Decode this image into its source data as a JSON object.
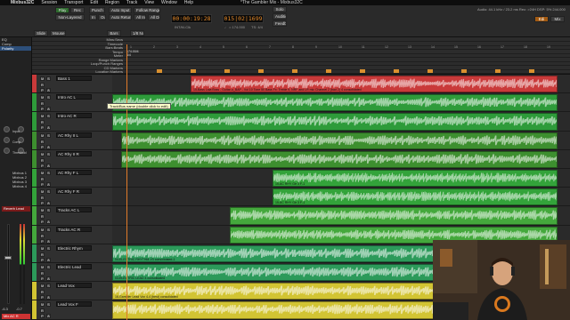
{
  "menubar": {
    "apple": "",
    "app": "Mixbus32C",
    "items": [
      "Session",
      "Transport",
      "Edit",
      "Region",
      "Track",
      "View",
      "Window",
      "Help"
    ],
    "window_title": "*The Gambler Mix - Mixbus32C"
  },
  "toolbar": {
    "punch": "Punch",
    "in": "In",
    "out": "Out",
    "auto_input": "Auto Input",
    "follow_range": "Follow Range",
    "play": "Play",
    "rec": "Rec",
    "non_layered": "Non-Layered",
    "all_in": "All In",
    "all_dsk": "All Disk",
    "auto_return": "Auto Return",
    "clock_primary": "00:00:19:28",
    "clock_secondary": "015|02|1699",
    "clock_primary_sub": "INT/M-Clk",
    "clock_secondary_sub": "TS: 4/4",
    "clock_secondary_sub2": "♩ = 174.000",
    "solo": "Solo",
    "audition": "Audition",
    "feedback": "Feedback",
    "status": "Audio: 44.1 kHz / 23.2 ms   Rec: >24H   DSP: 5%   244.000",
    "editor_btn": "Edi",
    "mixer_btn": "Mix"
  },
  "editbar": {
    "slide": "Slide",
    "mouse": "Mouse",
    "bars": "Bars",
    "nudge_toggle": "No Grid",
    "bars2": "1/8 Note"
  },
  "leftpanel": {
    "items": [
      "EQ",
      "Comp",
      "Polarity"
    ],
    "selected": "Polarity",
    "labels": [
      "Input",
      "Comp",
      "Threshold",
      "Makeup",
      "Attack",
      "Release"
    ],
    "buses": [
      "Mixbus 1",
      "Mixbus 2",
      "Mixbus 3",
      "Mixbus 4"
    ],
    "fx_label": "Reverb Lead",
    "master_label": "Mix AC R",
    "meter_val_1": "-6.3",
    "meter_val_2": "-0.7"
  },
  "rulers": {
    "rows": [
      "Mins:Secs",
      "Timecode",
      "Bars:Beats",
      "Tempo",
      "Meter",
      "Range Markers",
      "Loop/Punch Ranges",
      "CD Markers",
      "Location Markers"
    ],
    "time_sig": "4/4",
    "tempo_value": "174.00/4",
    "bar_numbers": [
      "1",
      "2",
      "3",
      "4",
      "5",
      "6",
      "7",
      "8",
      "9",
      "10",
      "11",
      "12",
      "13",
      "14",
      "15",
      "16",
      "17",
      "18",
      "19"
    ]
  },
  "tracks": [
    {
      "name": "Bass 1",
      "color": "#c93a3a",
      "region_label": "15-Bass Lala Boss - Guitar-o_BAP - Vol 10 Tone 50 Bass Fx: Treble 9, NRF and LR mic Channel 2 (bad 2) 4 consolidated"
    },
    {
      "name": "Intro AC L",
      "color": "#2e9b3a",
      "region_label": "Audio 1 1"
    },
    {
      "name": "Intro AC R",
      "color": "#2e9b3a",
      "region_label": ""
    },
    {
      "name": "AC Rhy II L",
      "color": "#3d8f2f",
      "region_label": ""
    },
    {
      "name": "AC Rhy II R",
      "color": "#3d8f2f",
      "region_label": ""
    },
    {
      "name": "AC Rhy F L",
      "color": "#33a33a",
      "region_label": "15-AC RHY Gtr 3 F-1"
    },
    {
      "name": "AC Rhy F R",
      "color": "#33a33a",
      "region_label": "15-AC RHY Gtr 3 F-1"
    },
    {
      "name": "Tracks AC L",
      "color": "#44a83c",
      "region_label": ""
    },
    {
      "name": "Tracks AC R",
      "color": "#44a83c",
      "region_label": ""
    },
    {
      "name": "Electric Rhym",
      "color": "#2c9a5a",
      "region_label": "04-ELECTRIC RHYTHM-V3 consolidated-1"
    },
    {
      "name": "Electric Lead",
      "color": "#2c9a5a",
      "region_label": "03-ELECTRIC LEAD 4 consolidated"
    },
    {
      "name": "Lead Vox",
      "color": "#d2c433",
      "region_label": "16-Gambler Lead Vox 4-4 (best) consolidated"
    },
    {
      "name": "Lead Vox F",
      "color": "#d2c433",
      "region_label": ""
    }
  ],
  "tooltip": "Track/Bus name (double click to edit)",
  "track_buttons": {
    "m": "M",
    "s": "S",
    "r": "R",
    "p": "P",
    "a": "A"
  }
}
